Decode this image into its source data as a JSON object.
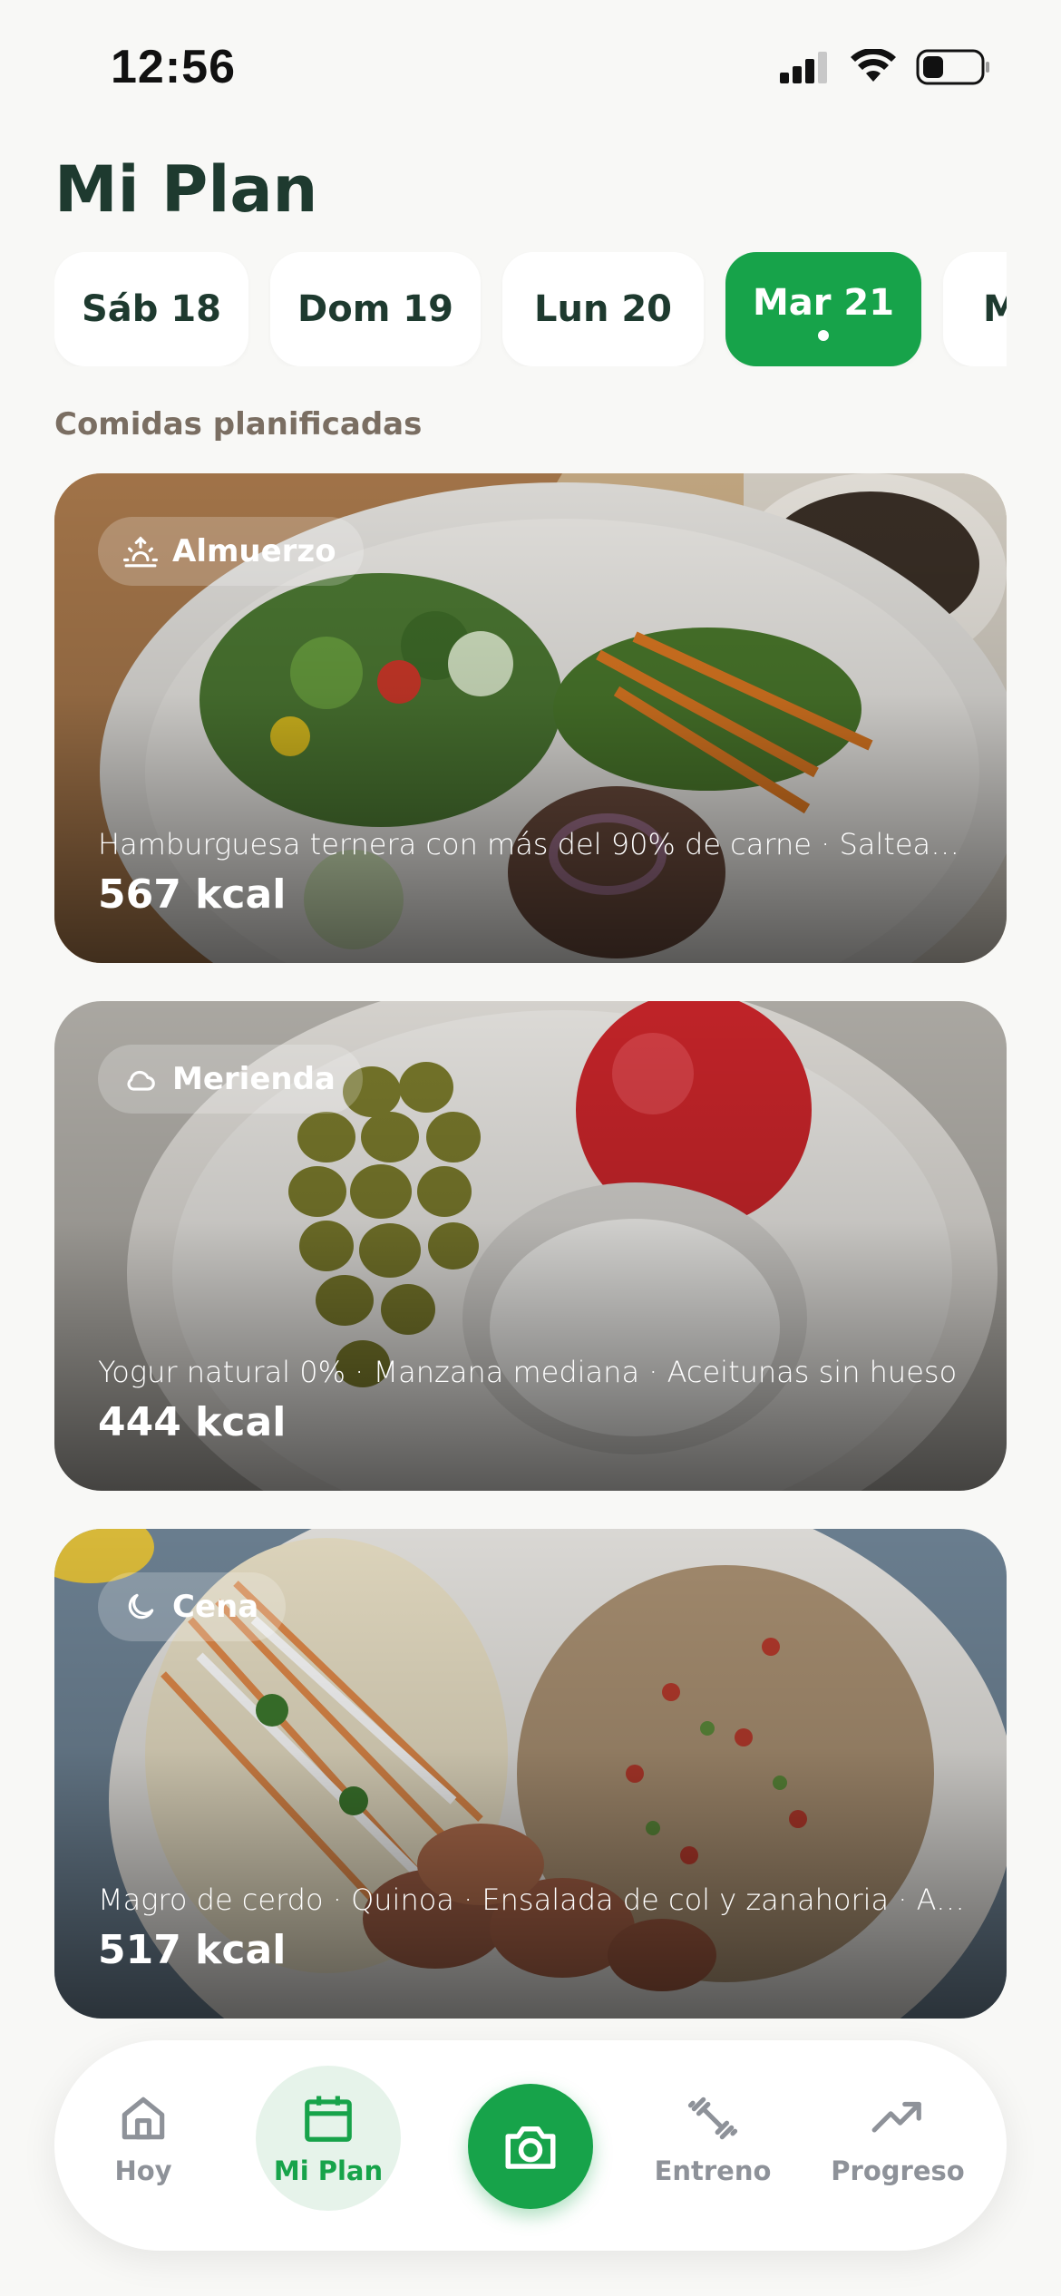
{
  "status_bar": {
    "time": "12:56"
  },
  "page_title": "Mi Plan",
  "days": [
    {
      "label": "Sáb 18",
      "active": false
    },
    {
      "label": "Dom 19",
      "active": false
    },
    {
      "label": "Lun 20",
      "active": false
    },
    {
      "label": "Mar 21",
      "active": true
    },
    {
      "label": "M",
      "active": false
    }
  ],
  "section_label": "Comidas planificadas",
  "meals": [
    {
      "type": "Almuerzo",
      "icon": "sunrise-icon",
      "items": "Hamburguesa ternera con más del 90% de carne · Saltead...",
      "kcal": "567 kcal"
    },
    {
      "type": "Merienda",
      "icon": "cloud-icon",
      "items": "Yogur natural 0% · Manzana mediana · Aceitunas sin hueso",
      "kcal": "444 kcal"
    },
    {
      "type": "Cena",
      "icon": "moon-icon",
      "items": "Magro de cerdo · Quinoa · Ensalada de col y zanahoria · Ace...",
      "kcal": "517 kcal"
    }
  ],
  "tabs": {
    "home": "Hoy",
    "plan": "Mi Plan",
    "camera": "camera-icon",
    "workout": "Entreno",
    "progress": "Progreso"
  },
  "colors": {
    "accent": "#17a34a",
    "title": "#1e3a2f",
    "section": "#7a6e62"
  }
}
